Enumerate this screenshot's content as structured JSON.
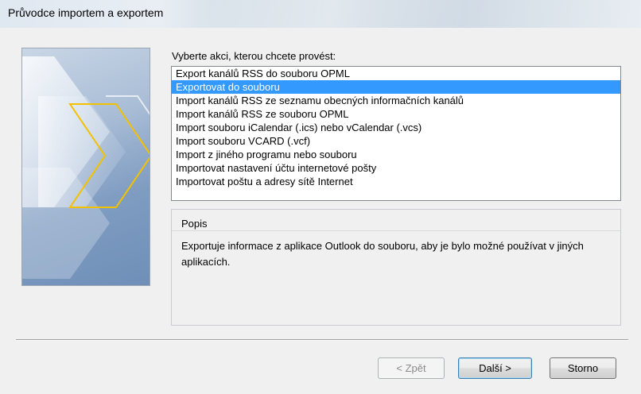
{
  "window": {
    "title": "Průvodce importem a exportem"
  },
  "actions": {
    "prompt": "Vyberte akci, kterou chcete provést:",
    "items": [
      {
        "label": "Export kanálů RSS do souboru OPML",
        "selected": false
      },
      {
        "label": "Exportovat do souboru",
        "selected": true
      },
      {
        "label": "Import kanálů RSS ze seznamu obecných  informačních kanálů",
        "selected": false
      },
      {
        "label": "Import kanálů RSS ze souboru OPML",
        "selected": false
      },
      {
        "label": "Import souboru iCalendar (.ics) nebo vCalendar (.vcs)",
        "selected": false
      },
      {
        "label": "Import souboru VCARD (.vcf)",
        "selected": false
      },
      {
        "label": "Import z jiného programu nebo souboru",
        "selected": false
      },
      {
        "label": "Importovat nastavení účtu internetové pošty",
        "selected": false
      },
      {
        "label": "Importovat poštu a adresy sítě Internet",
        "selected": false
      }
    ]
  },
  "description": {
    "title": "Popis",
    "text": "Exportuje informace z aplikace Outlook do souboru, aby je bylo možné používat v jiných aplikacích."
  },
  "buttons": {
    "back": "< Zpět",
    "next": "Další >",
    "cancel": "Storno"
  },
  "colors": {
    "selection": "#3399ff",
    "arrow_outline": "#f2c200"
  }
}
